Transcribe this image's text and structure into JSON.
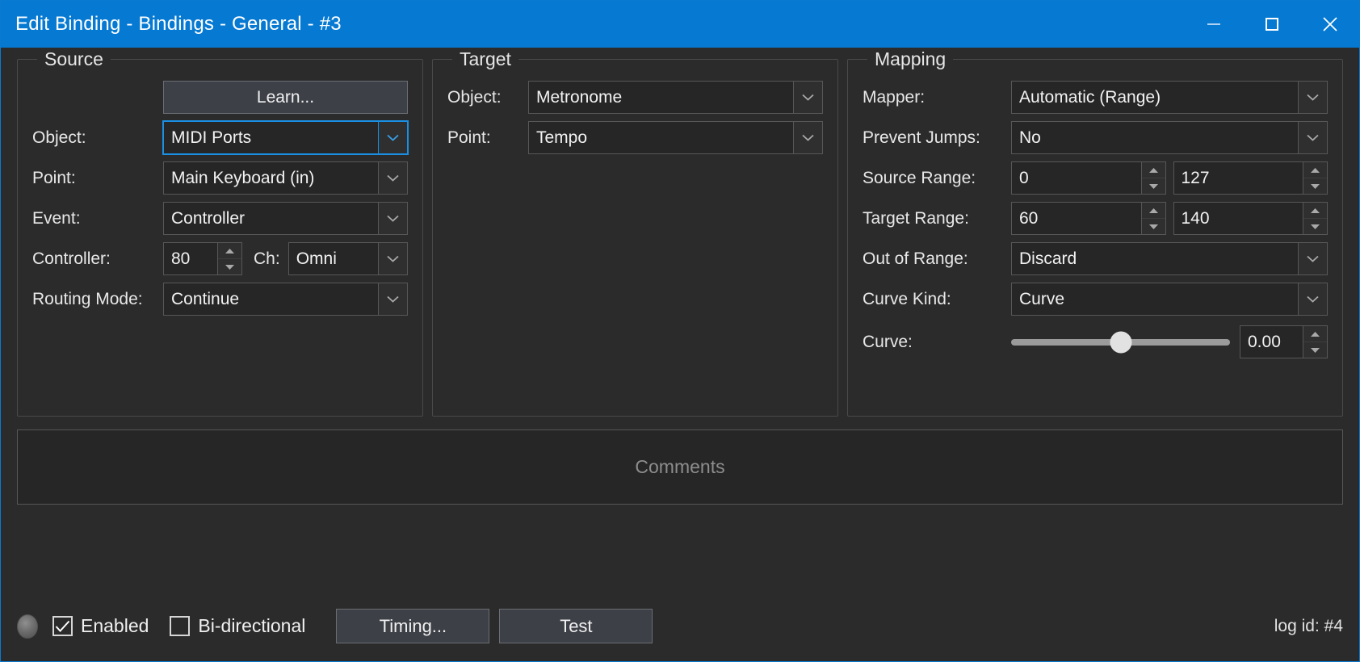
{
  "window": {
    "title": "Edit Binding - Bindings - General - #3",
    "accent_color": "#0679d2",
    "background_color": "#2b2b2b",
    "controls": [
      {
        "name": "minimize",
        "glyph": "minimize-icon"
      },
      {
        "name": "maximize",
        "glyph": "maximize-icon"
      },
      {
        "name": "close",
        "glyph": "close-icon"
      }
    ]
  },
  "source": {
    "legend": "Source",
    "learn_button": "Learn...",
    "object": {
      "label": "Object:",
      "value": "MIDI Ports",
      "focused": true
    },
    "point": {
      "label": "Point:",
      "value": "Main Keyboard (in)"
    },
    "event": {
      "label": "Event:",
      "value": "Controller"
    },
    "controller": {
      "label": "Controller:",
      "value": "80"
    },
    "channel": {
      "label": "Ch:",
      "value": "Omni"
    },
    "routing_mode": {
      "label": "Routing Mode:",
      "value": "Continue"
    }
  },
  "target": {
    "legend": "Target",
    "object": {
      "label": "Object:",
      "value": "Metronome"
    },
    "point": {
      "label": "Point:",
      "value": "Tempo"
    }
  },
  "mapping": {
    "legend": "Mapping",
    "mapper": {
      "label": "Mapper:",
      "value": "Automatic (Range)"
    },
    "prevent_jumps": {
      "label": "Prevent Jumps:",
      "value": "No"
    },
    "source_range": {
      "label": "Source Range:",
      "min": "0",
      "max": "127"
    },
    "target_range": {
      "label": "Target Range:",
      "min": "60",
      "max": "140"
    },
    "out_of_range": {
      "label": "Out of Range:",
      "value": "Discard"
    },
    "curve_kind": {
      "label": "Curve Kind:",
      "value": "Curve"
    },
    "curve": {
      "label": "Curve:",
      "value": "0.00",
      "slider_percent": 50
    }
  },
  "comments": {
    "placeholder": "Comments",
    "value": ""
  },
  "footer": {
    "enabled": {
      "label": "Enabled",
      "checked": true
    },
    "bidirectional": {
      "label": "Bi-directional",
      "checked": false
    },
    "timing_button": "Timing...",
    "test_button": "Test",
    "log_id": "log id: #4"
  }
}
